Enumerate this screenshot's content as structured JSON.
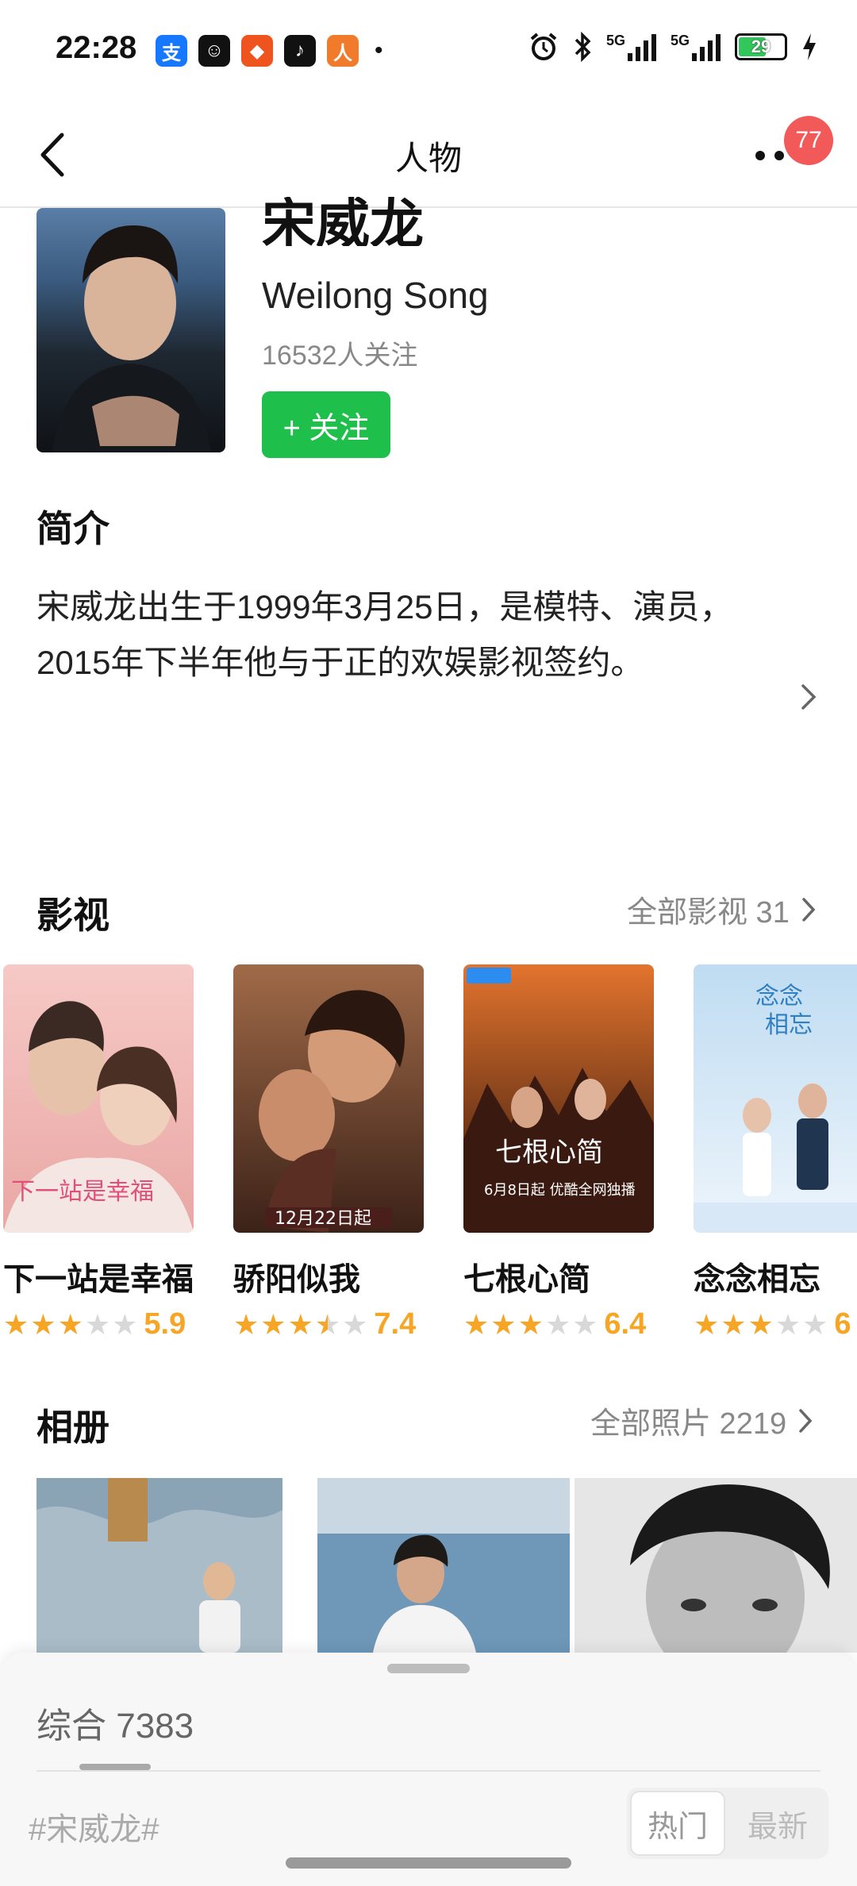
{
  "status_bar": {
    "time": "22:28",
    "apps": [
      {
        "icon": "alipay-icon",
        "glyph": "支",
        "color": "#1677ff"
      },
      {
        "icon": "app-smile-icon",
        "glyph": "☺",
        "color": "#111111"
      },
      {
        "icon": "app-orange-icon",
        "glyph": "◆",
        "color": "#f0541e"
      },
      {
        "icon": "app-music-icon",
        "glyph": "♪",
        "color": "#111111"
      },
      {
        "icon": "app-person-icon",
        "glyph": "人",
        "color": "#f07b2a"
      }
    ],
    "more_dot": "•",
    "signal1": "5G",
    "signal2": "5G",
    "battery": "29"
  },
  "nav": {
    "title": "人物",
    "badge": "77"
  },
  "profile": {
    "name_cn": "宋威龙",
    "name_en": "Weilong Song",
    "followers": "16532人关注",
    "follow_button": "+ 关注"
  },
  "intro": {
    "heading": "简介",
    "text": "宋威龙出生于1999年3月25日，是模特、演员，2015年下半年他与于正的欢娱影视签约。"
  },
  "films": {
    "heading": "影视",
    "more": "全部影视 31",
    "items": [
      {
        "title": "下一站是幸福",
        "score": "5.9",
        "stars": 3,
        "poster_colors": [
          "#f6c9c6",
          "#e9a7a4"
        ]
      },
      {
        "title": "骄阳似我",
        "score": "7.4",
        "stars": 3.5,
        "poster_colors": [
          "#8a5a3e",
          "#3b2218"
        ]
      },
      {
        "title": "七根心简",
        "score": "6.4",
        "stars": 3,
        "poster_colors": [
          "#d9642a",
          "#3a1a10"
        ]
      },
      {
        "title": "念念相忘",
        "score": "6",
        "stars": 3,
        "poster_colors": [
          "#bfdcf2",
          "#e8f2fb"
        ]
      }
    ]
  },
  "album": {
    "heading": "相册",
    "more": "全部照片 2219"
  },
  "sheet": {
    "tab": "综合 7383",
    "hashtag": "#宋威龙#",
    "hot": "热门",
    "new": "最新"
  }
}
